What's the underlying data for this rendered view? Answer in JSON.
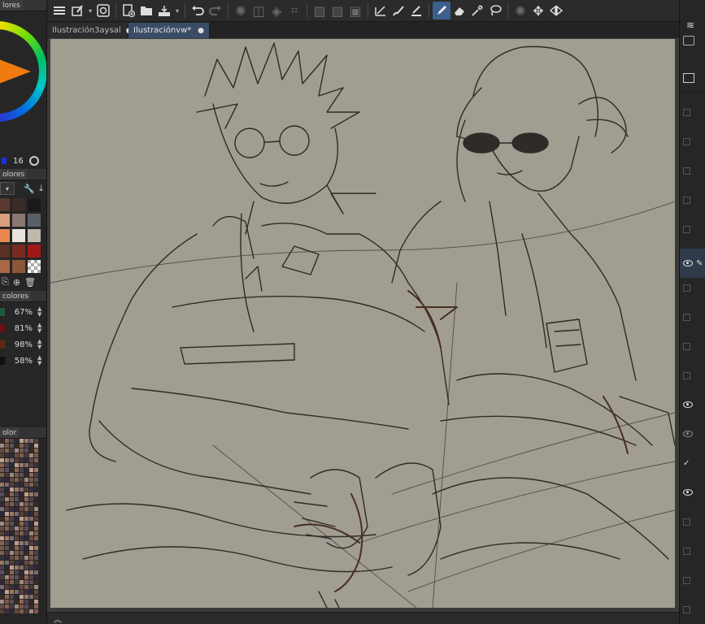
{
  "tabs": [
    {
      "label": "Ilustración3aysal",
      "dot": "●"
    },
    {
      "label": "Ilustraciónvw*",
      "dot": "●"
    }
  ],
  "left_panel": {
    "wheel_header": "lores",
    "brush_size": "16",
    "swatches_header": "olores",
    "color_settings_header": "colores",
    "color_settings": [
      {
        "color": "#1f5a3a",
        "value": "67%"
      },
      {
        "color": "#6a1010",
        "value": "81%"
      },
      {
        "color": "#5a2a10",
        "value": "98%"
      },
      {
        "color": "#101010",
        "value": "58%"
      }
    ],
    "mix_header": "olor"
  },
  "toolbar": {
    "icons": [
      "menu-icon",
      "selection-tool-icon",
      "layer-icon",
      "new-canvas-icon",
      "open-file-icon",
      "save-icon",
      "undo-icon",
      "redo-icon",
      "spinner-icon",
      "fill-icon",
      "transform-icon",
      "grid-icon",
      "pen-tool-icon",
      "eraser-icon",
      "eyedropper-icon",
      "lasso-icon",
      "move-icon",
      "flip-icon"
    ]
  },
  "colors": {
    "canvas": "#a19d91",
    "active_tab": "#3a4c66",
    "accent": "#f07a10"
  }
}
